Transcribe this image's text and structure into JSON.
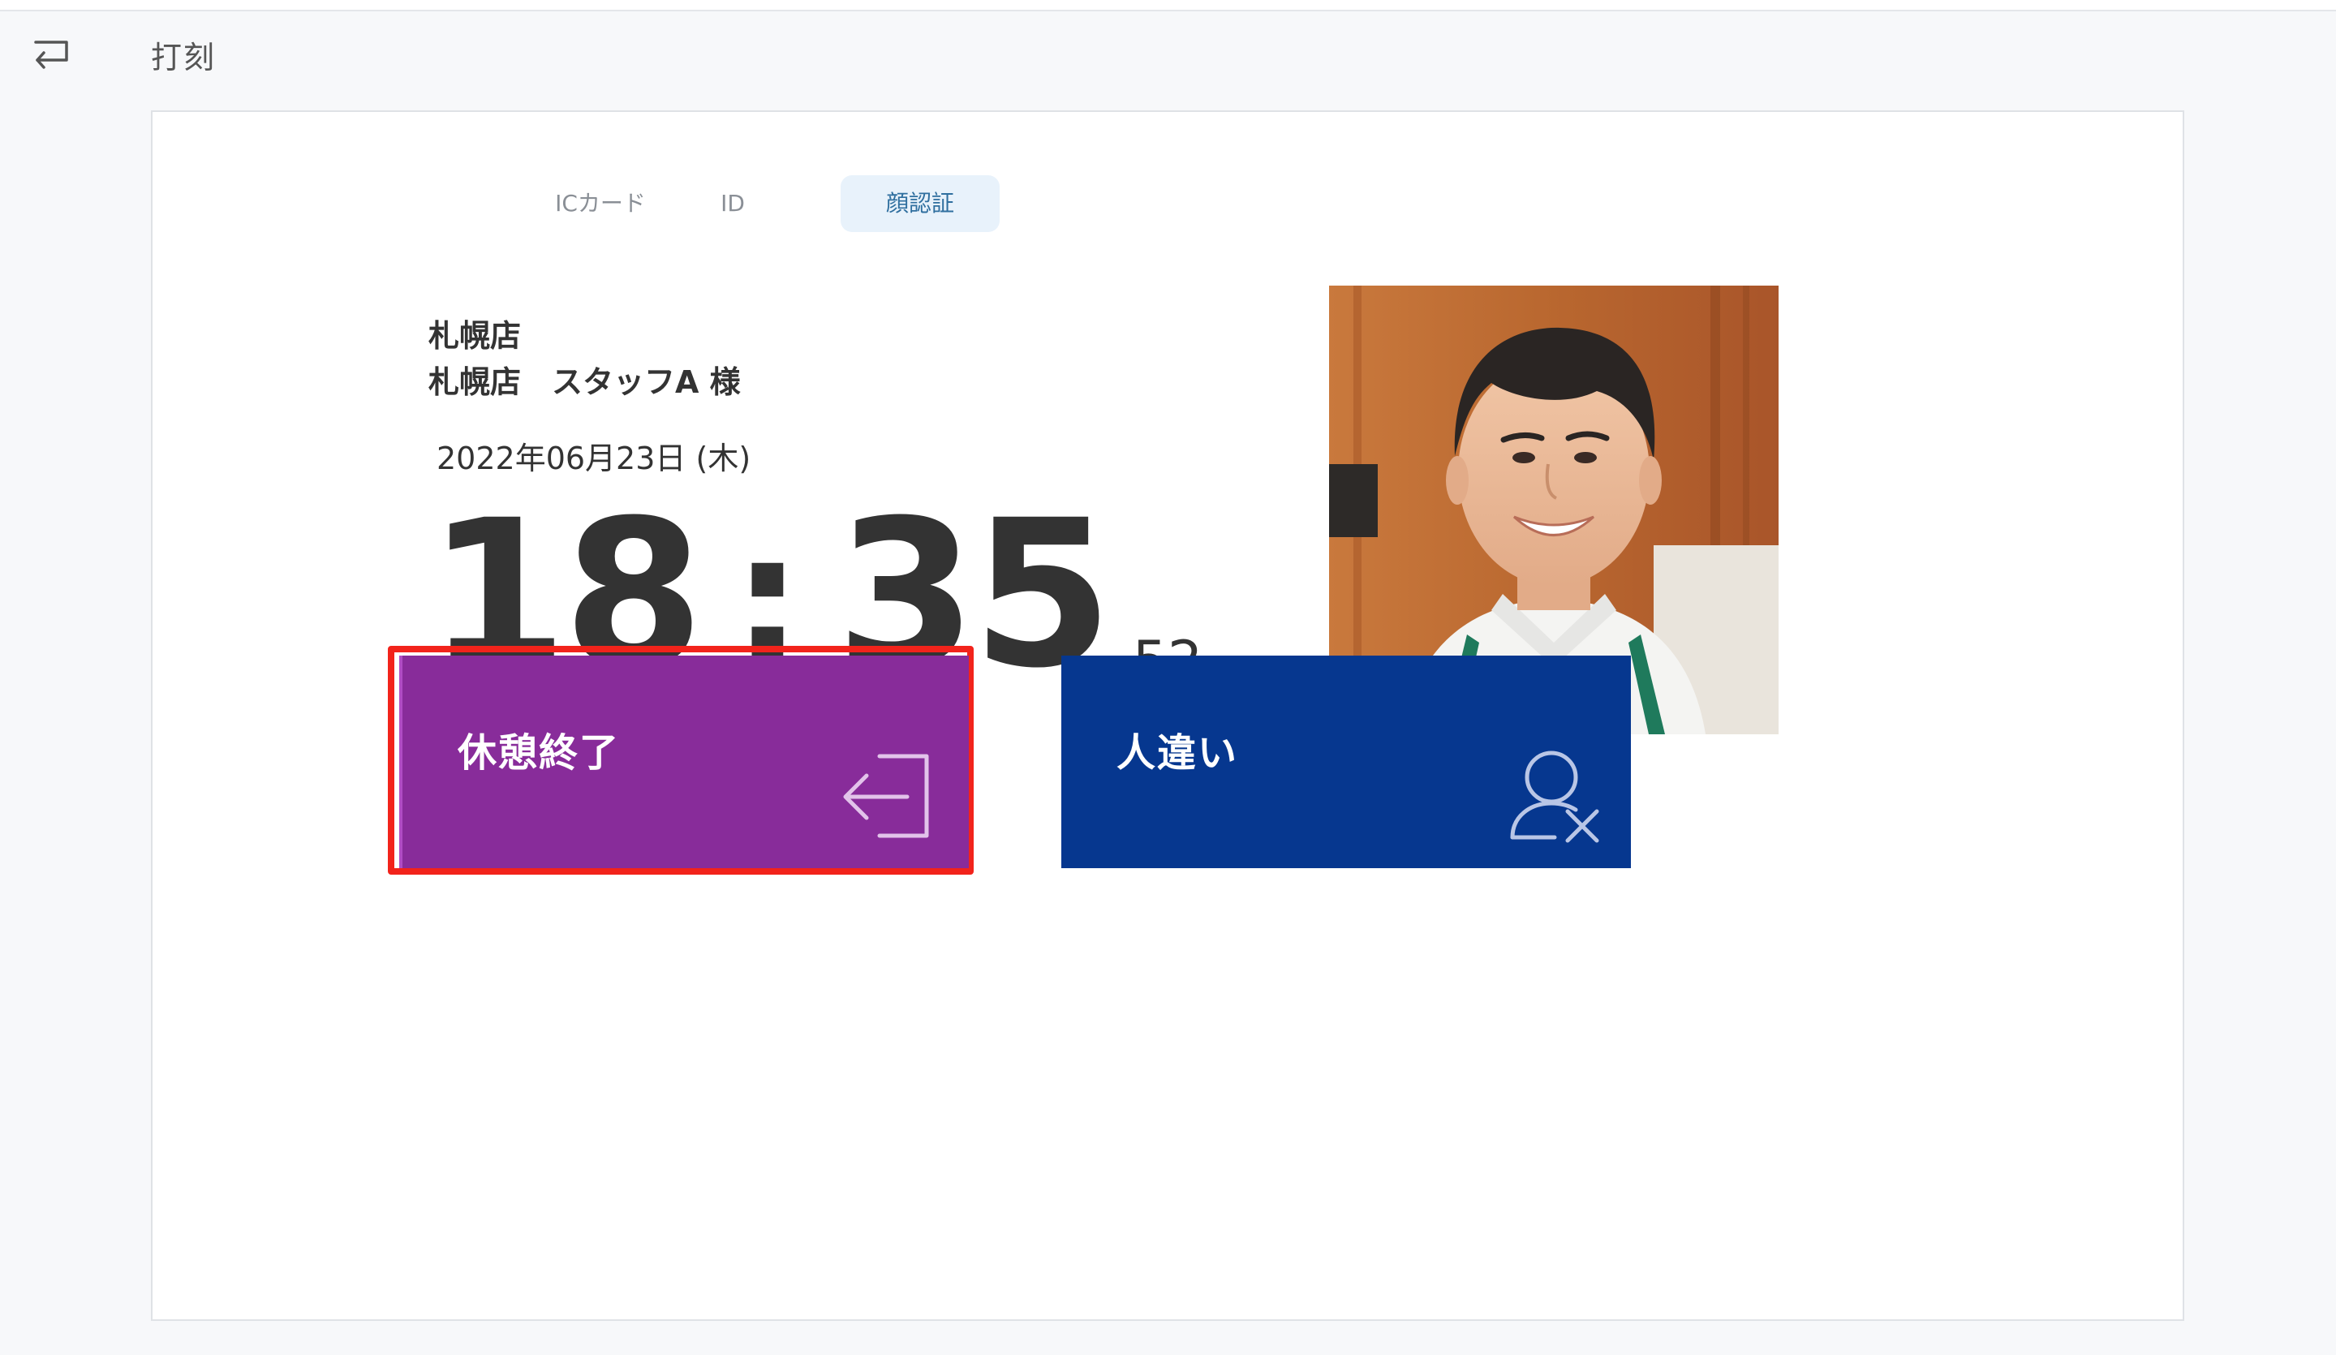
{
  "header": {
    "title": "打刻",
    "back_icon": "return-arrow-icon"
  },
  "tabs": [
    {
      "label": "ICカード",
      "active": false
    },
    {
      "label": "ID",
      "active": false
    },
    {
      "label": "顔認証",
      "active": true
    }
  ],
  "user": {
    "store": "札幌店",
    "staff_line": "札幌店　スタッフA 様"
  },
  "datetime": {
    "date": "2022年06月23日 (木)",
    "hour": "18",
    "separator": ":",
    "minute": "35",
    "second": "52"
  },
  "actions": {
    "break_end": {
      "label": "休憩終了",
      "icon": "logout-arrow-icon",
      "color": "#882c9a",
      "highlighted": true,
      "highlight_color": "#f2231b"
    },
    "wrong_person": {
      "label": "人違い",
      "icon": "user-remove-icon",
      "color": "#06378f"
    }
  },
  "photo": {
    "alt": "staff-face-photo"
  },
  "colors": {
    "active_tab_bg": "#e8f2fb",
    "active_tab_text": "#2f6f9f"
  }
}
